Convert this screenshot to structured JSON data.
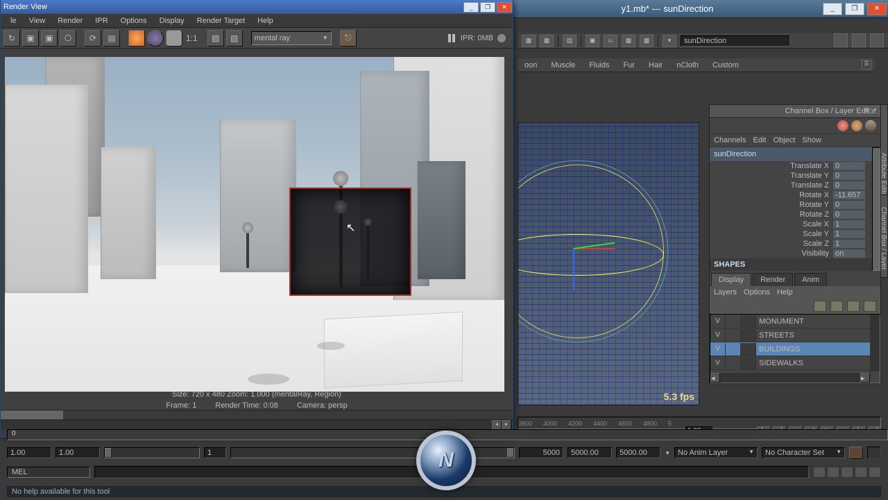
{
  "maya": {
    "title_suffix": "y1.mb*   ---   sunDirection",
    "input_name": "sunDirection"
  },
  "shelf_tabs": [
    "oon",
    "Muscle",
    "Fluids",
    "Fur",
    "Hair",
    "nCloth",
    "Custom"
  ],
  "render_view": {
    "title": "Render View",
    "menus": [
      "le",
      "View",
      "Render",
      "IPR",
      "Options",
      "Display",
      "Render Target",
      "Help"
    ],
    "renderer": "mental ray",
    "ipr_status": "IPR: 0MB",
    "ratio": "1:1",
    "status_line_1": "Size: 720 x 480 Zoom: 1.000        (mentalRay, Region)",
    "status_line_2": {
      "frame": "Frame: 1",
      "time": "Render Time: 0:08",
      "camera": "Camera: persp"
    },
    "ruler_zero": "0"
  },
  "channel_box": {
    "title": "Channel Box / Layer Editor",
    "menus": [
      "Channels",
      "Edit",
      "Object",
      "Show"
    ],
    "object": "sunDirection",
    "attrs": [
      {
        "n": "Translate X",
        "v": "0"
      },
      {
        "n": "Translate Y",
        "v": "0"
      },
      {
        "n": "Translate Z",
        "v": "0"
      },
      {
        "n": "Rotate X",
        "v": "-11.657"
      },
      {
        "n": "Rotate Y",
        "v": "0"
      },
      {
        "n": "Rotate Z",
        "v": "0"
      },
      {
        "n": "Scale X",
        "v": "1"
      },
      {
        "n": "Scale Y",
        "v": "1"
      },
      {
        "n": "Scale Z",
        "v": "1"
      },
      {
        "n": "Visibility",
        "v": "on"
      }
    ],
    "shapes_label": "SHAPES"
  },
  "layer_editor": {
    "tabs": [
      "Display",
      "Render",
      "Anim"
    ],
    "active_tab": 0,
    "menus": [
      "Layers",
      "Options",
      "Help"
    ],
    "layers": [
      {
        "vis": "V",
        "name": "MONUMENT",
        "selected": false
      },
      {
        "vis": "V",
        "name": "STREETS",
        "selected": false
      },
      {
        "vis": "V",
        "name": "BUILDINGS",
        "selected": true
      },
      {
        "vis": "V",
        "name": "SIDEWALKS",
        "selected": false
      }
    ]
  },
  "side_tabs": [
    "Attribute Editor",
    "Channel Box / Layer Editor"
  ],
  "viewport": {
    "fps": "5.3 fps"
  },
  "timeline": {
    "ticks": [
      {
        "p": 0,
        "l": "3800"
      },
      {
        "p": 10,
        "l": "4000"
      },
      {
        "p": 20,
        "l": "4200"
      },
      {
        "p": 30,
        "l": "4400"
      },
      {
        "p": 40,
        "l": "4600"
      },
      {
        "p": 50,
        "l": "4800"
      },
      {
        "p": 60,
        "l": "5"
      }
    ],
    "end": "1.00"
  },
  "range": {
    "start_a": "1.00",
    "start_b": "1.00",
    "cur": "1",
    "end_a": "5000",
    "end_b": "5000.00",
    "end_c": "5000.00",
    "anim_layer": "No Anim Layer",
    "char_set": "No Character Set"
  },
  "cmd": {
    "label": "MEL"
  },
  "help_line": "No help available for this tool"
}
